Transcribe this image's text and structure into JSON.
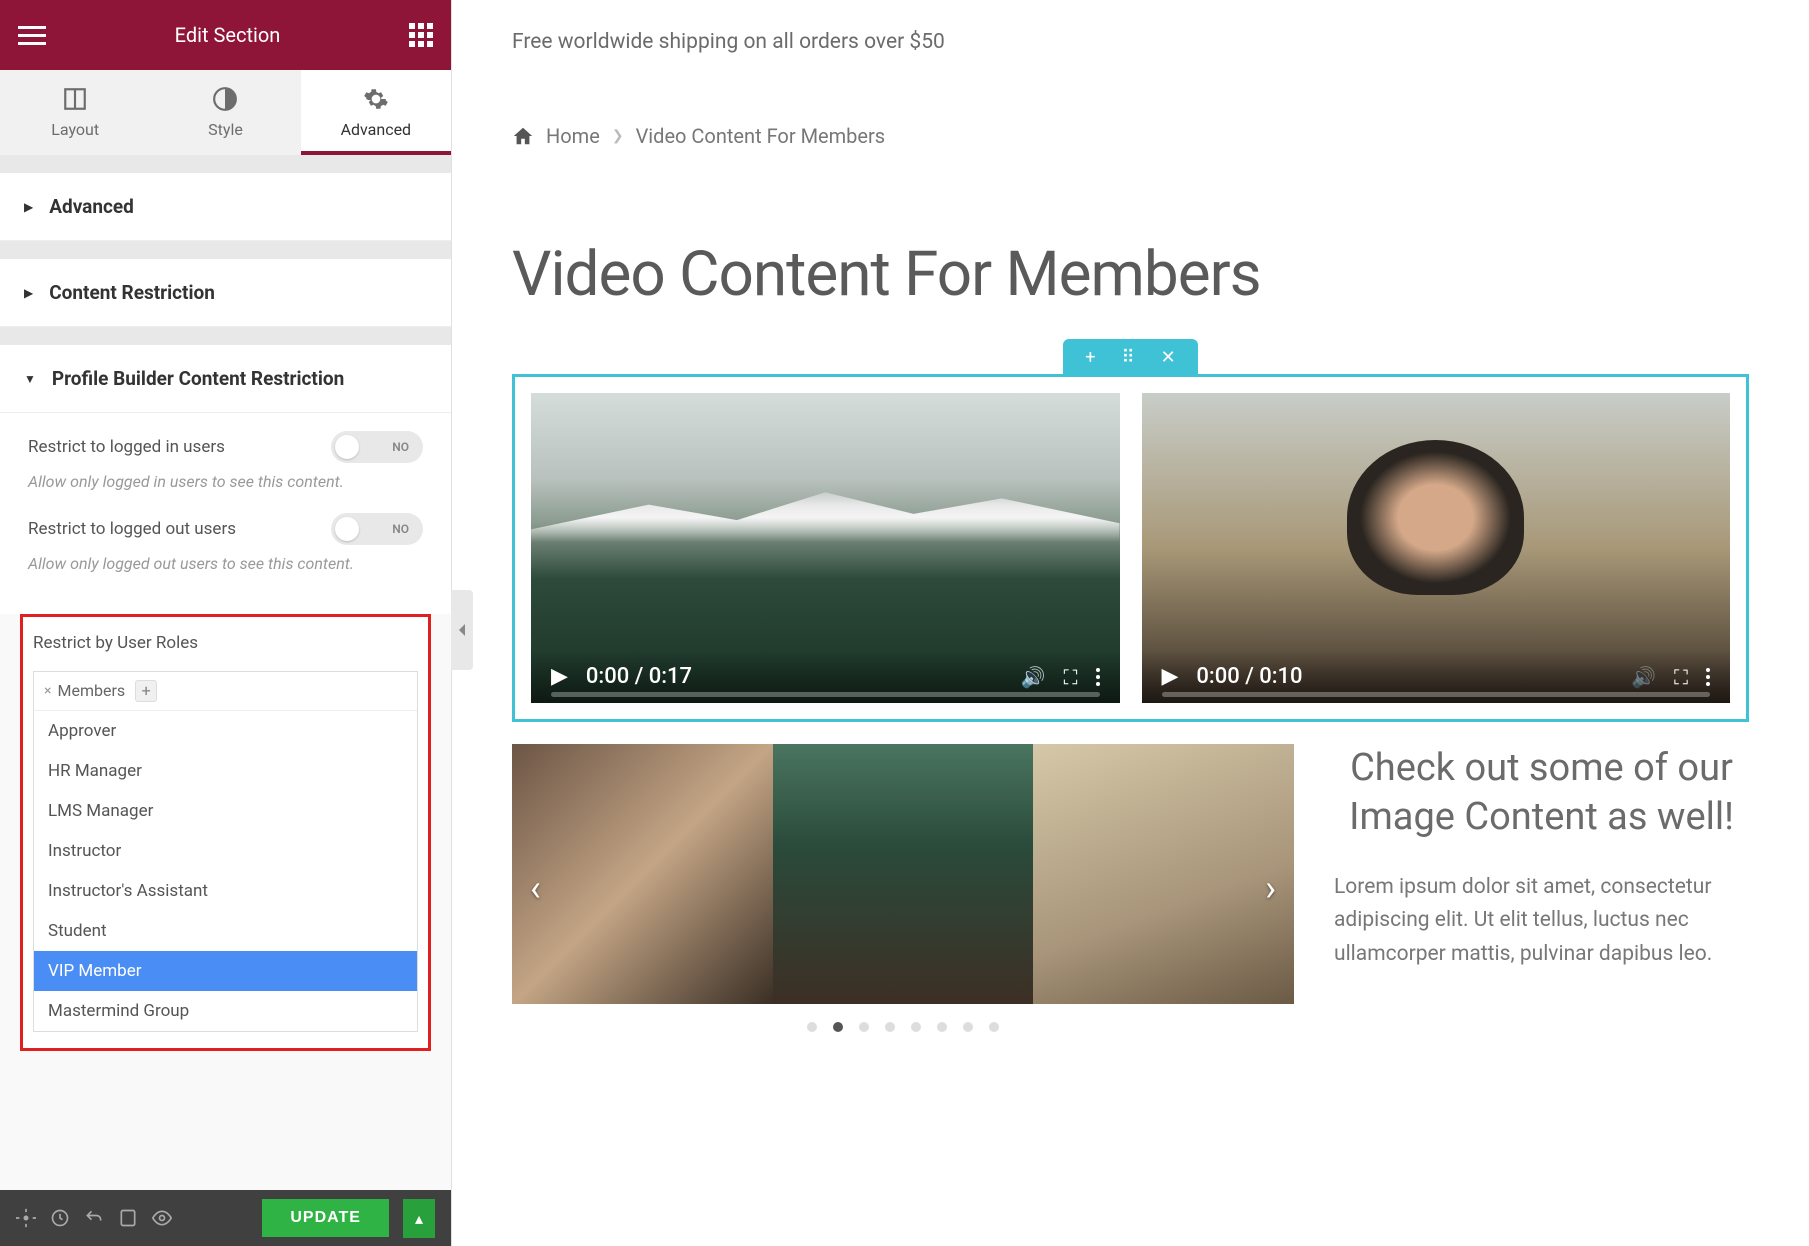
{
  "sidebar": {
    "header_title": "Edit Section",
    "tabs": {
      "layout": "Layout",
      "style": "Style",
      "advanced": "Advanced"
    },
    "sections": {
      "advanced": "Advanced",
      "content_restriction": "Content Restriction",
      "pb_restriction": "Profile Builder Content Restriction"
    },
    "controls": {
      "restrict_logged_in": {
        "label": "Restrict to logged in users",
        "value": "NO",
        "help": "Allow only logged in users to see this content."
      },
      "restrict_logged_out": {
        "label": "Restrict to logged out users",
        "value": "NO",
        "help": "Allow only logged out users to see this content."
      },
      "restrict_roles": {
        "label": "Restrict by User Roles",
        "selected": "Members",
        "options": [
          "Approver",
          "HR Manager",
          "LMS Manager",
          "Instructor",
          "Instructor's Assistant",
          "Student",
          "VIP Member",
          "Mastermind Group"
        ],
        "highlighted": "VIP Member"
      }
    },
    "update_button": "UPDATE"
  },
  "main": {
    "shipping": "Free worldwide shipping on all orders over $50",
    "breadcrumb": {
      "home": "Home",
      "current": "Video Content For Members"
    },
    "heading": "Video Content For Members",
    "videos": [
      {
        "time": "0:00 / 0:17",
        "muted": false
      },
      {
        "time": "0:00 / 0:10",
        "muted": true
      }
    ],
    "carousel": {
      "active_dot": 1,
      "dot_count": 8
    },
    "aside": {
      "heading": "Check out some of our Image Content as well!",
      "text": "Lorem ipsum dolor sit amet, consectetur adipiscing elit. Ut elit tellus, luctus nec ullamcorper mattis, pulvinar dapibus leo."
    }
  }
}
